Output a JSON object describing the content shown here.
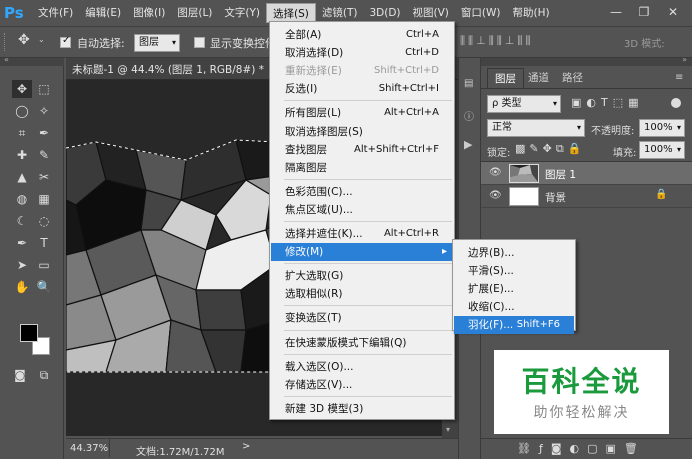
{
  "app": {
    "logo": "Ps"
  },
  "menubar": {
    "items": [
      "文件(F)",
      "编辑(E)",
      "图像(I)",
      "图层(L)",
      "文字(Y)",
      "选择(S)",
      "滤镜(T)",
      "3D(D)",
      "视图(V)",
      "窗口(W)",
      "帮助(H)"
    ],
    "active_index": 5
  },
  "window_controls": {
    "minimize": "—",
    "restore": "❐",
    "close": "✕"
  },
  "options": {
    "auto_select_label": "自动选择:",
    "auto_select_value": "图层",
    "transform_controls_label": "显示变换控件",
    "mode_3d_label": "3D 模式:"
  },
  "document": {
    "tab_title": "未标题-1 @ 44.4% (图层 1, RGB/8#) *",
    "close": "×",
    "zoom": "44.37%",
    "doc_size": "文档:1.72M/1.72M"
  },
  "layers_panel": {
    "tabs": [
      "图层",
      "通道",
      "路径"
    ],
    "kind_filter": "ρ 类型",
    "blend_mode": "正常",
    "opacity_label": "不透明度:",
    "opacity_value": "100%",
    "lock_label": "锁定:",
    "fill_label": "填充:",
    "fill_value": "100%",
    "layers": [
      {
        "name": "图层 1",
        "selected": true
      },
      {
        "name": "背景",
        "selected": false
      }
    ]
  },
  "select_menu": {
    "items": [
      {
        "label": "全部(A)",
        "shortcut": "Ctrl+A"
      },
      {
        "label": "取消选择(D)",
        "shortcut": "Ctrl+D"
      },
      {
        "label": "重新选择(E)",
        "shortcut": "Shift+Ctrl+D",
        "disabled": true
      },
      {
        "label": "反选(I)",
        "shortcut": "Shift+Ctrl+I"
      },
      {
        "sep": true
      },
      {
        "label": "所有图层(L)",
        "shortcut": "Alt+Ctrl+A"
      },
      {
        "label": "取消选择图层(S)",
        "shortcut": ""
      },
      {
        "label": "查找图层",
        "shortcut": "Alt+Shift+Ctrl+F"
      },
      {
        "label": "隔离图层",
        "shortcut": ""
      },
      {
        "sep": true
      },
      {
        "label": "色彩范围(C)...",
        "shortcut": ""
      },
      {
        "label": "焦点区域(U)...",
        "shortcut": ""
      },
      {
        "sep": true
      },
      {
        "label": "选择并遮住(K)...",
        "shortcut": "Alt+Ctrl+R"
      },
      {
        "label": "修改(M)",
        "shortcut": "",
        "submenu": true,
        "highlighted": true
      },
      {
        "sep": true
      },
      {
        "label": "扩大选取(G)",
        "shortcut": ""
      },
      {
        "label": "选取相似(R)",
        "shortcut": ""
      },
      {
        "sep": true
      },
      {
        "label": "变换选区(T)",
        "shortcut": ""
      },
      {
        "sep": true
      },
      {
        "label": "在快速蒙版模式下编辑(Q)",
        "shortcut": ""
      },
      {
        "sep": true
      },
      {
        "label": "载入选区(O)...",
        "shortcut": ""
      },
      {
        "label": "存储选区(V)...",
        "shortcut": ""
      },
      {
        "sep": true
      },
      {
        "label": "新建 3D 模型(3)",
        "shortcut": ""
      }
    ]
  },
  "modify_submenu": {
    "items": [
      {
        "label": "边界(B)...",
        "shortcut": ""
      },
      {
        "label": "平滑(S)...",
        "shortcut": ""
      },
      {
        "label": "扩展(E)...",
        "shortcut": ""
      },
      {
        "label": "收缩(C)...",
        "shortcut": ""
      },
      {
        "label": "羽化(F)...",
        "shortcut": "Shift+F6",
        "highlighted": true
      }
    ]
  },
  "watermark": {
    "title": "百科全说",
    "subtitle": "助你轻松解决"
  },
  "colors": {
    "accent": "#2a7fd6",
    "ps_blue": "#31a8ff",
    "watermark_green": "#1a9a3c"
  }
}
